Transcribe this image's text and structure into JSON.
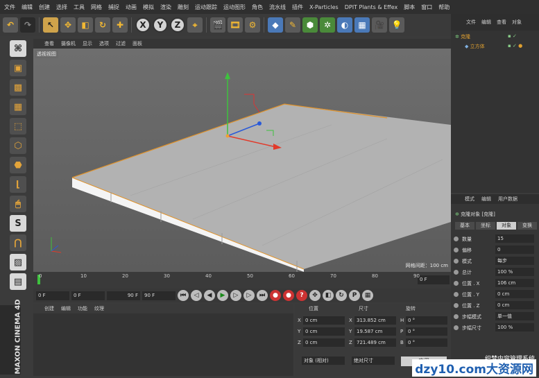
{
  "menu": [
    "文件",
    "编辑",
    "创建",
    "选择",
    "工具",
    "网格",
    "捕捉",
    "动画",
    "模拟",
    "渲染",
    "雕刻",
    "运动跟踪",
    "运动图形",
    "角色",
    "流水线",
    "插件",
    "X-Particles",
    "DPIT Plants & Effex",
    "脚本",
    "窗口",
    "帮助"
  ],
  "toolbar": {
    "axis_x": "X",
    "axis_y": "Y",
    "axis_z": "Z"
  },
  "viewport": {
    "menu": [
      "查看",
      "摄像机",
      "显示",
      "选项",
      "过滤",
      "面板"
    ],
    "label": "透视视图",
    "grid_spacing": "网格间距：100 cm"
  },
  "timeline": {
    "ticks": [
      "0",
      "10",
      "20",
      "30",
      "40",
      "50",
      "60",
      "70",
      "80",
      "90"
    ],
    "current_frame": "0 F"
  },
  "controls": {
    "start": "0 F",
    "range_start": "0 F",
    "range_end": "90 F",
    "end": "90 F"
  },
  "material": {
    "menu": [
      "创建",
      "编辑",
      "功能",
      "纹理"
    ]
  },
  "coordinates": {
    "headers": {
      "position": "位置",
      "size": "尺寸",
      "rotation": "旋转"
    },
    "rows": [
      {
        "axis": "X",
        "pos": "0 cm",
        "size_axis": "X",
        "size": "313.852 cm",
        "rot_axis": "H",
        "rot": "0 °"
      },
      {
        "axis": "Y",
        "pos": "0 cm",
        "size_axis": "Y",
        "size": "19.587 cm",
        "rot_axis": "P",
        "rot": "0 °"
      },
      {
        "axis": "Z",
        "pos": "0 cm",
        "size_axis": "Z",
        "size": "721.489 cm",
        "rot_axis": "B",
        "rot": "0 °"
      }
    ],
    "mode": "对象 (相对)",
    "size_mode": "绝对尺寸",
    "apply": "应用"
  },
  "objects": {
    "tabs": [
      "文件",
      "编辑",
      "查看",
      "对象"
    ],
    "items": [
      "克隆",
      "立方体"
    ]
  },
  "attributes": {
    "tabs": [
      "模式",
      "编辑",
      "用户数据"
    ],
    "object_title": "克隆对象 [克隆]",
    "subtabs": [
      "基本",
      "坐标",
      "对象",
      "变换"
    ],
    "rows": [
      {
        "label": "数量",
        "value": "15"
      },
      {
        "label": "偏移",
        "value": "0"
      },
      {
        "label": "模式",
        "value": "每步"
      },
      {
        "label": "总计",
        "value": "100 %"
      },
      {
        "label": "位置 . X",
        "value": "106 cm"
      },
      {
        "label": "位置 . Y",
        "value": "0 cm"
      },
      {
        "label": "位置 . Z",
        "value": "0 cm"
      },
      {
        "label": "步幅模式",
        "value": "单一值"
      },
      {
        "label": "步幅尺寸",
        "value": "100 %"
      }
    ]
  },
  "brand": {
    "line1": "MAXON",
    "line2": "CINEMA 4D"
  },
  "watermark": {
    "site": "dzy10.com大资源网",
    "caption": "织梦内容管理系统"
  }
}
